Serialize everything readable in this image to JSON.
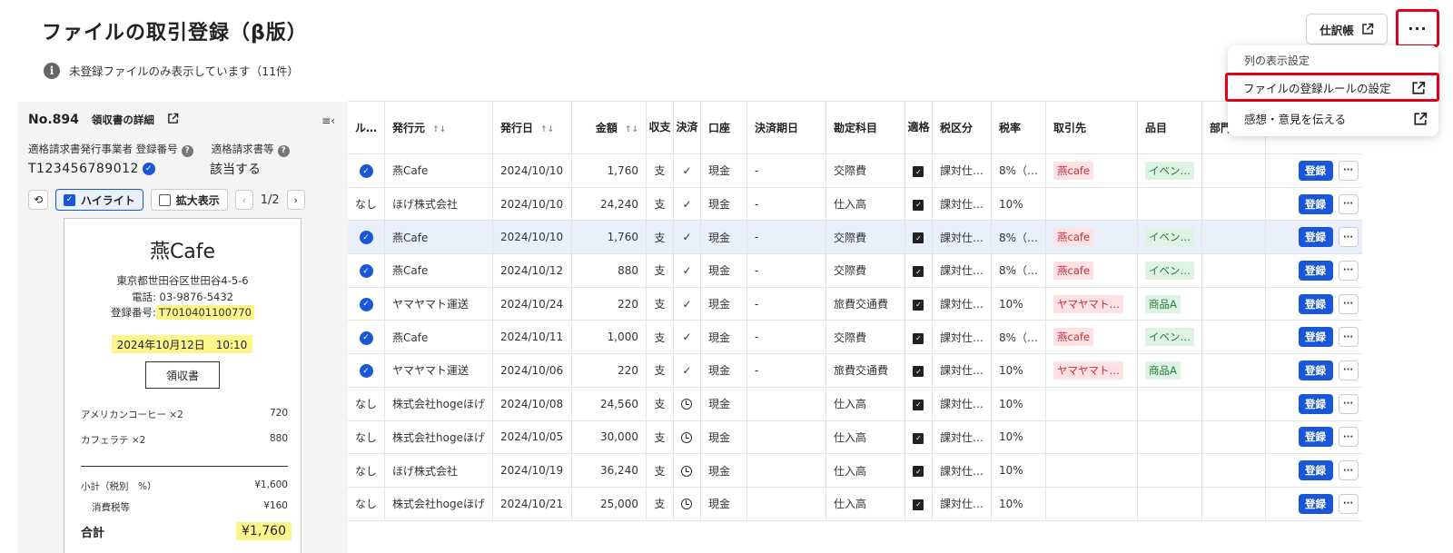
{
  "header": {
    "title": "ファイルの取引登録（β版）",
    "info_text": "未登録ファイルのみ表示しています（11件）",
    "info_icon": "info-icon",
    "journal_button": "仕訳帳",
    "more_button": "···"
  },
  "dropdown": {
    "header": "列の表示設定",
    "items": [
      {
        "label": "ファイルの登録ルールの設定"
      },
      {
        "label": "感想・意見を伝える"
      }
    ]
  },
  "detail": {
    "no": "No.894",
    "receipt_link": "領収書の詳細",
    "collapse_icon": "≡‹",
    "reg_label": "適格請求書発行事業者 登録番号",
    "qual_label": "適格請求書等",
    "reg_value": "T123456789012",
    "qual_value": "該当する",
    "highlight_label": "ハイライト",
    "zoom_label": "拡大表示",
    "page": "1/2"
  },
  "receipt": {
    "shop": "燕Cafe",
    "address": "東京都世田谷区世田谷4-5-6",
    "tel": "電話: 03-9876-5432",
    "reg_prefix": "登録番号:",
    "reg_no": "T7010401100770",
    "date": "2024年10月12日　10:10",
    "doc_type": "領収書",
    "items": [
      {
        "name": "アメリカンコーヒー ×2",
        "price": "720"
      },
      {
        "name": "カフェラテ ×2",
        "price": "880"
      }
    ],
    "subtotal_label": "小計（税別　%）",
    "subtotal": "¥1,600",
    "tax_label": "消費税等",
    "tax": "¥160",
    "total_label": "合計",
    "total": "¥1,760"
  },
  "table": {
    "headers": {
      "rule": "ル…",
      "issuer": "発行元",
      "date": "発行日",
      "amount": "金額",
      "inout": "収支",
      "settle": "決済",
      "account": "口座",
      "due": "決済期日",
      "subject": "勘定科目",
      "qualified": "適格",
      "taxcat": "税区分",
      "rate": "税率",
      "partner": "取引先",
      "item": "品目",
      "dept": "部門"
    },
    "register_label": "登録",
    "row_more_label": "···",
    "rows": [
      {
        "rule": "✓",
        "issuer": "燕Cafe",
        "date": "2024/10/10",
        "amount": "1,760",
        "inout": "支",
        "settle": "check",
        "account": "現金",
        "due": "-",
        "subject": "交際費",
        "taxcat": "課対仕…",
        "rate": "8%（…",
        "partner": "燕cafe",
        "item": "イベン…"
      },
      {
        "rule": "なし",
        "issuer": "ほげ株式会社",
        "date": "2024/10/10",
        "amount": "24,240",
        "inout": "支",
        "settle": "check",
        "account": "現金",
        "due": "-",
        "subject": "仕入高",
        "taxcat": "課対仕…",
        "rate": "10%",
        "partner": "",
        "item": ""
      },
      {
        "rule": "✓",
        "issuer": "燕Cafe",
        "date": "2024/10/10",
        "amount": "1,760",
        "inout": "支",
        "settle": "check",
        "account": "現金",
        "due": "-",
        "subject": "交際費",
        "taxcat": "課対仕…",
        "rate": "8%（…",
        "partner": "燕cafe",
        "item": "イベン…",
        "selected": true
      },
      {
        "rule": "✓",
        "issuer": "燕Cafe",
        "date": "2024/10/12",
        "amount": "880",
        "inout": "支",
        "settle": "check",
        "account": "現金",
        "due": "-",
        "subject": "交際費",
        "taxcat": "課対仕…",
        "rate": "8%（…",
        "partner": "燕cafe",
        "item": "イベン…"
      },
      {
        "rule": "✓",
        "issuer": "ヤマヤマト運送",
        "date": "2024/10/24",
        "amount": "220",
        "inout": "支",
        "settle": "check",
        "account": "現金",
        "due": "-",
        "subject": "旅費交通費",
        "taxcat": "課対仕…",
        "rate": "10%",
        "partner": "ヤマヤマト…",
        "item": "商品A"
      },
      {
        "rule": "✓",
        "issuer": "燕Cafe",
        "date": "2024/10/11",
        "amount": "1,000",
        "inout": "支",
        "settle": "check",
        "account": "現金",
        "due": "-",
        "subject": "交際費",
        "taxcat": "課対仕…",
        "rate": "8%（…",
        "partner": "燕cafe",
        "item": "イベン…"
      },
      {
        "rule": "✓",
        "issuer": "ヤマヤマト運送",
        "date": "2024/10/06",
        "amount": "220",
        "inout": "支",
        "settle": "check",
        "account": "現金",
        "due": "-",
        "subject": "旅費交通費",
        "taxcat": "課対仕…",
        "rate": "10%",
        "partner": "ヤマヤマト…",
        "item": "商品A"
      },
      {
        "rule": "なし",
        "issuer": "株式会社hogeほげ",
        "date": "2024/10/08",
        "amount": "24,560",
        "inout": "支",
        "settle": "clock",
        "account": "現金",
        "due": "",
        "subject": "仕入高",
        "taxcat": "課対仕…",
        "rate": "10%",
        "partner": "",
        "item": ""
      },
      {
        "rule": "なし",
        "issuer": "株式会社hogeほげ",
        "date": "2024/10/05",
        "amount": "30,000",
        "inout": "支",
        "settle": "clock",
        "account": "現金",
        "due": "",
        "subject": "仕入高",
        "taxcat": "課対仕…",
        "rate": "10%",
        "partner": "",
        "item": ""
      },
      {
        "rule": "なし",
        "issuer": "ほげ株式会社",
        "date": "2024/10/19",
        "amount": "36,240",
        "inout": "支",
        "settle": "clock",
        "account": "現金",
        "due": "",
        "subject": "仕入高",
        "taxcat": "課対仕…",
        "rate": "10%",
        "partner": "",
        "item": ""
      },
      {
        "rule": "なし",
        "issuer": "株式会社hogeほげ",
        "date": "2024/10/21",
        "amount": "25,000",
        "inout": "支",
        "settle": "clock",
        "account": "現金",
        "due": "",
        "subject": "仕入高",
        "taxcat": "課対仕…",
        "rate": "10%",
        "partner": "",
        "item": ""
      }
    ]
  },
  "colors": {
    "primary": "#1a57d6",
    "danger_outline": "#e0001b",
    "expense": "#e0262c",
    "selected_row": "#e9effb"
  }
}
